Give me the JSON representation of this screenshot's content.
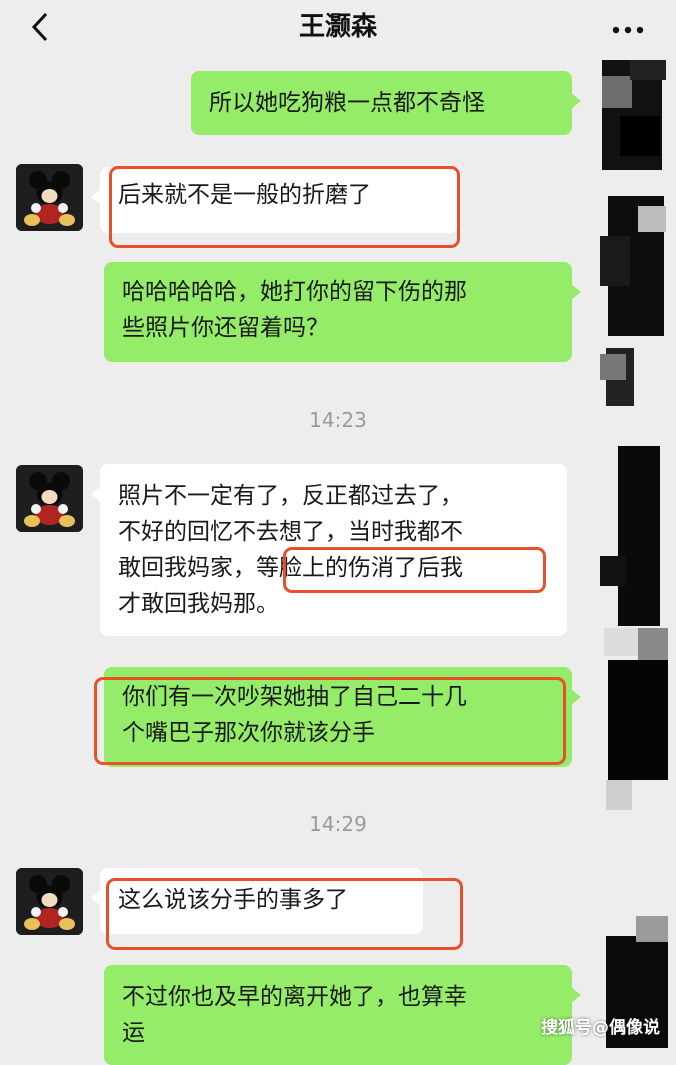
{
  "header": {
    "back_icon": "chevron-left-icon",
    "title": "王灏森",
    "more_icon": "more-dots-icon"
  },
  "messages": [
    {
      "side": "right",
      "text": "所以她吃狗粮一点都不奇怪"
    },
    {
      "side": "left",
      "text": "后来就不是一般的折磨了"
    },
    {
      "side": "right",
      "lines": [
        "哈哈哈哈哈，她打你的留下伤的那",
        "些照片你还留着吗？"
      ]
    },
    {
      "side": "left",
      "lines": [
        "照片不一定有了，反正都过去了，",
        "不好的回忆不去想了，当时我都不",
        "敢回我妈家，",
        "等脸上的伤消了后我",
        "才敢回我妈那。"
      ]
    },
    {
      "side": "right",
      "lines": [
        "你们有一次吵架她抽了自己二十几",
        "个嘴巴子那次你就该分手"
      ]
    },
    {
      "side": "left",
      "text": "这么说该分手的事多了"
    },
    {
      "side": "right",
      "lines": [
        "不过你也及早的离开她了，也算幸",
        "运"
      ]
    }
  ],
  "timestamps": [
    "14:23",
    "14:29"
  ],
  "watermark": "搜狐号@偶像说",
  "colors": {
    "background": "#ededed",
    "bubble_sent": "#95ec69",
    "bubble_received": "#ffffff",
    "highlight": "#e8502a"
  }
}
